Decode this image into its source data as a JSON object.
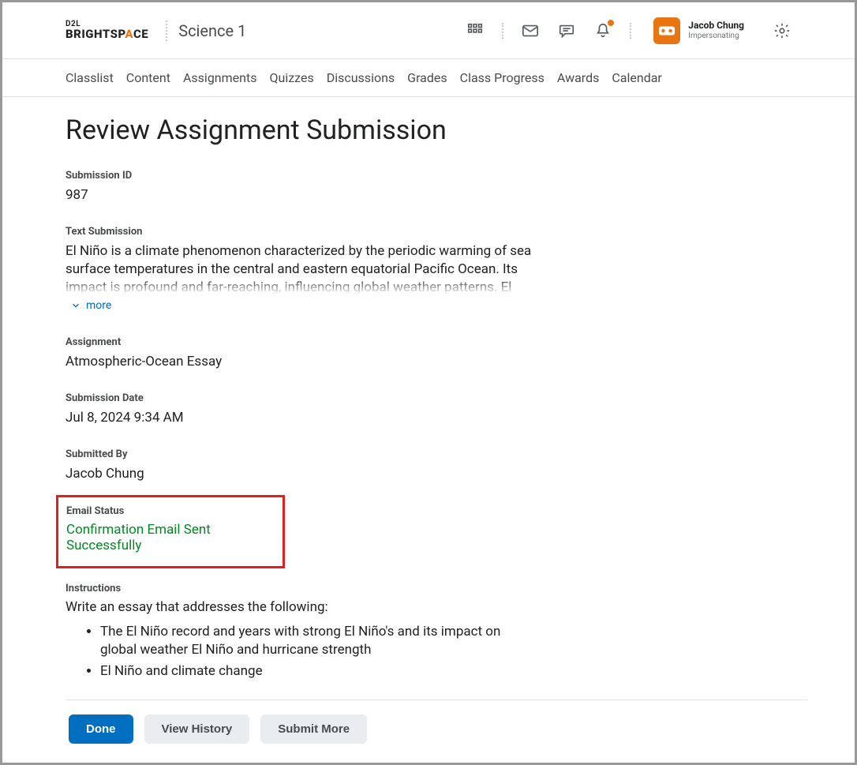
{
  "header": {
    "logo_top": "D2L",
    "logo_bottom_pre": "BRIGHTSP",
    "logo_bottom_carat": "A",
    "logo_bottom_post": "CE",
    "course_title": "Science 1",
    "user_name": "Jacob Chung",
    "user_sub": "Impersonating"
  },
  "nav": {
    "items": [
      "Classlist",
      "Content",
      "Assignments",
      "Quizzes",
      "Discussions",
      "Grades",
      "Class Progress",
      "Awards",
      "Calendar"
    ]
  },
  "page": {
    "title": "Review Assignment Submission",
    "submission_id_label": "Submission ID",
    "submission_id": "987",
    "text_submission_label": "Text Submission",
    "text_submission_body": "El Niño is a climate phenomenon characterized by the periodic warming of sea surface temperatures in the central and eastern equatorial Pacific Ocean. Its impact is profound and far-reaching, influencing global weather patterns. El Niño often leads to",
    "more_label": "more",
    "assignment_label": "Assignment",
    "assignment_value": "Atmospheric-Ocean Essay",
    "submission_date_label": "Submission Date",
    "submission_date_value": "Jul 8, 2024 9:34 AM",
    "submitted_by_label": "Submitted By",
    "submitted_by_value": "Jacob Chung",
    "email_status_label": "Email Status",
    "email_status_value": "Confirmation Email Sent Successfully",
    "instructions_label": "Instructions",
    "instructions_intro": "Write an essay that addresses the following:",
    "instructions_items": [
      "The El Niño record and years with strong El Niño's and its impact on global weather El Niño and hurricane strength",
      "El Niño and climate change"
    ]
  },
  "buttons": {
    "done": "Done",
    "view_history": "View History",
    "submit_more": "Submit More"
  }
}
